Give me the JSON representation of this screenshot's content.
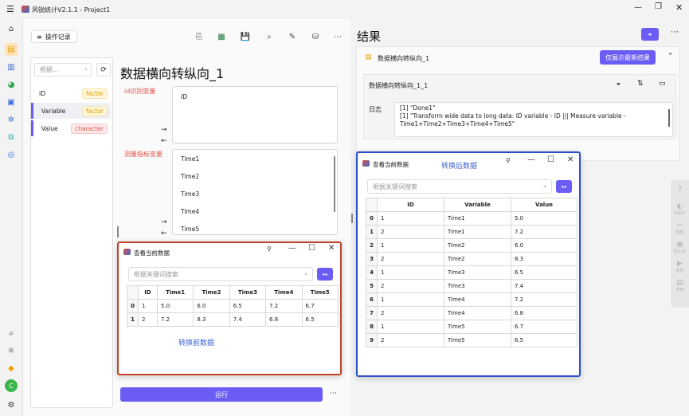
{
  "app": {
    "title": "风锐统计V2.1.1 - Project1"
  },
  "toolbar": {
    "log_label": "操作记录"
  },
  "var_panel": {
    "search_placeholder": "根据...",
    "items": [
      {
        "name": "ID",
        "type": "factor"
      },
      {
        "name": "Variable",
        "type": "factor"
      },
      {
        "name": "Value",
        "type": "character"
      }
    ]
  },
  "main": {
    "title": "数据横向转纵向_1",
    "id_label": "id识别变量",
    "id_vars": [
      "ID"
    ],
    "measure_label": "测量指标变量",
    "measure_vars": [
      "Time1",
      "Time2",
      "Time3",
      "Time4",
      "Time5"
    ],
    "run_label": "运行"
  },
  "before_window": {
    "title": "查看当前数据",
    "search_placeholder": "根据关键词搜索",
    "headers": [
      "ID",
      "Time1",
      "Time2",
      "Time3",
      "Time4",
      "Time5"
    ],
    "rows": [
      {
        "idx": "0",
        "cells": [
          "1",
          "5.0",
          "6.0",
          "6.5",
          "7.2",
          "6.7"
        ]
      },
      {
        "idx": "1",
        "cells": [
          "2",
          "7.2",
          "8.3",
          "7.4",
          "6.8",
          "6.5"
        ]
      }
    ],
    "caption": "转换前数据"
  },
  "results": {
    "title": "结果",
    "section_title": "数据横向转纵向_1",
    "show_latest_label": "仅展示最新结果",
    "card_title": "数据横向转纵向_1_1",
    "log_label": "日志",
    "log_lines": [
      "[1] \"Done1\"",
      "[1] \"Transform wide data to long data: ID variable - ID ||| Measure variable -",
      "Time1+Time2+Time3+Time4+Time5\""
    ]
  },
  "after_window": {
    "title": "查看当前数据",
    "caption": "转换后数据",
    "search_placeholder": "根据关键词搜索",
    "headers": [
      "ID",
      "Variable",
      "Value"
    ],
    "rows": [
      {
        "idx": "0",
        "cells": [
          "1",
          "Time1",
          "5.0"
        ]
      },
      {
        "idx": "1",
        "cells": [
          "2",
          "Time1",
          "7.2"
        ]
      },
      {
        "idx": "2",
        "cells": [
          "1",
          "Time2",
          "6.0"
        ]
      },
      {
        "idx": "3",
        "cells": [
          "2",
          "Time2",
          "8.3"
        ]
      },
      {
        "idx": "4",
        "cells": [
          "1",
          "Time3",
          "6.5"
        ]
      },
      {
        "idx": "5",
        "cells": [
          "2",
          "Time3",
          "7.4"
        ]
      },
      {
        "idx": "6",
        "cells": [
          "1",
          "Time4",
          "7.2"
        ]
      },
      {
        "idx": "7",
        "cells": [
          "2",
          "Time4",
          "6.8"
        ]
      },
      {
        "idx": "8",
        "cells": [
          "1",
          "Time5",
          "6.7"
        ]
      },
      {
        "idx": "9",
        "cells": [
          "2",
          "Time5",
          "6.5"
        ]
      }
    ]
  },
  "floatbar": {
    "items": [
      "AI助手",
      "截图",
      "取企查",
      "录屏",
      "搜索"
    ]
  },
  "colors": {
    "accent": "#6a5cf5",
    "highlight_red": "#c8412b",
    "highlight_blue": "#2b4fc8",
    "annot_red": "#e0504a",
    "annot_blue": "#3a5fd0"
  }
}
